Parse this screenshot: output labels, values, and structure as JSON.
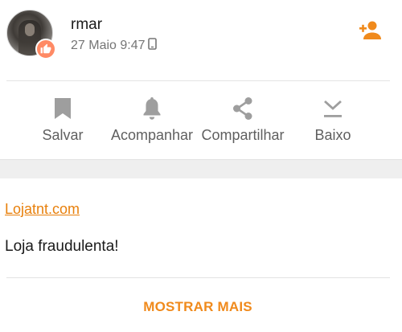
{
  "post": {
    "username": "rmar",
    "timestamp": "27 Maio 9:47",
    "device_icon": "phone-icon",
    "badge_icon": "thumbs-up-icon",
    "follow_icon": "add-person-icon",
    "link_text": "Lojatnt.com",
    "body": "Loja fraudulenta!"
  },
  "actions": [
    {
      "label": "Salvar",
      "icon": "bookmark-icon"
    },
    {
      "label": "Acompanhar",
      "icon": "bell-icon"
    },
    {
      "label": "Compartilhar",
      "icon": "share-icon"
    },
    {
      "label": "Baixo",
      "icon": "download-icon"
    }
  ],
  "footer": {
    "show_more_label": "MOSTRAR MAIS"
  },
  "colors": {
    "accent": "#F08A1C",
    "badge": "#FF8A65",
    "icon_gray": "#9E9E9E",
    "separator": "#EFEFEF"
  }
}
